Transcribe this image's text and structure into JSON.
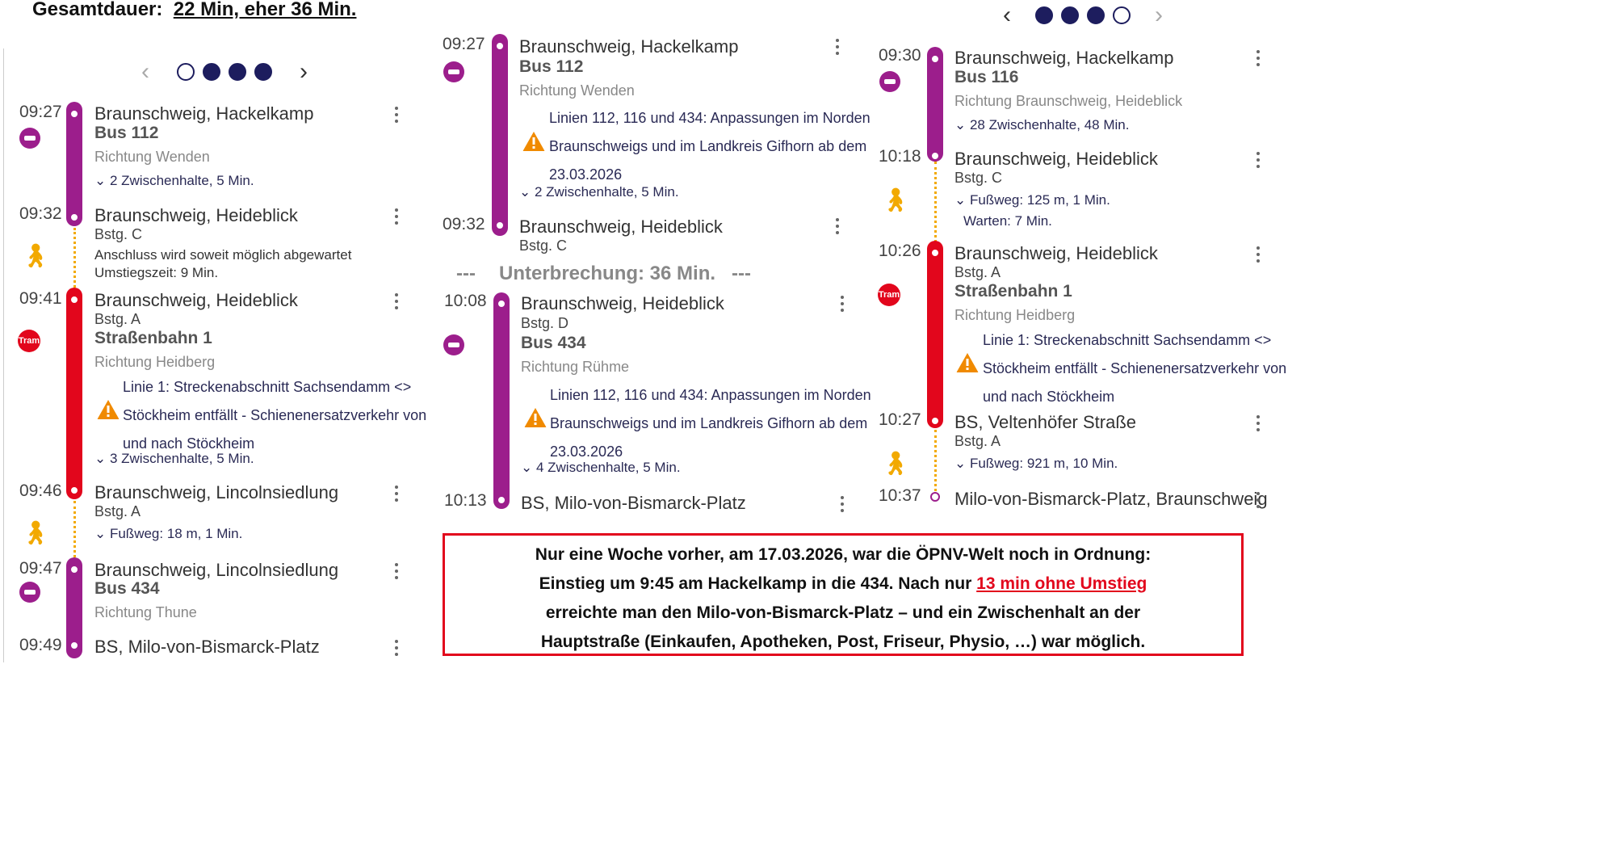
{
  "headline": {
    "label": "Gesamtdauer:",
    "value": "22 Min, eher 36 Min."
  },
  "left": {
    "pager": {
      "prev": "‹",
      "next": "›"
    },
    "rows": {
      "r1": {
        "time": "09:27",
        "stop": "Braunschweig, Hackelkamp",
        "line": "Bus 112",
        "dir": "Richtung Wenden",
        "stops": "⌄ 2 Zwischenhalte, 5 Min."
      },
      "r2": {
        "time": "09:32",
        "stop": "Braunschweig, Heideblick",
        "bay": "Bstg. C",
        "note1": "Anschluss wird soweit möglich abgewartet",
        "note2": "Umstiegszeit: 9 Min."
      },
      "r3": {
        "time": "09:41",
        "stop": "Braunschweig, Heideblick",
        "bay": "Bstg. A",
        "line": "Straßenbahn 1",
        "dir": "Richtung Heidberg",
        "alert1": "Linie 1: Streckenabschnitt Sachsendamm <>",
        "alert2": "Stöckheim entfällt - Schienenersatzverkehr von",
        "alert3": "und nach Stöckheim",
        "stops": "⌄ 3 Zwischenhalte, 5 Min.",
        "tram": "Tram"
      },
      "r4": {
        "time": "09:46",
        "stop": "Braunschweig, Lincolnsiedlung",
        "bay": "Bstg. A",
        "walk": "⌄ Fußweg: 18 m, 1 Min."
      },
      "r5": {
        "time": "09:47",
        "stop": "Braunschweig, Lincolnsiedlung",
        "line": "Bus 434",
        "dir": "Richtung Thune"
      },
      "r6": {
        "time": "09:49",
        "stop": "BS, Milo-von-Bismarck-Platz"
      }
    }
  },
  "mid": {
    "r1": {
      "time": "09:27",
      "stop": "Braunschweig, Hackelkamp",
      "line": "Bus 112",
      "dir": "Richtung Wenden",
      "alert1": "Linien 112, 116 und 434: Anpassungen im Norden",
      "alert2": "Braunschweigs und im Landkreis Gifhorn ab dem",
      "alert3": "23.03.2026",
      "stops": "⌄ 2 Zwischenhalte, 5 Min."
    },
    "r2": {
      "time": "09:32",
      "stop": "Braunschweig, Heideblick",
      "bay": "Bstg. C"
    },
    "break": {
      "dash1": "---",
      "text": "Unterbrechung: 36 Min.",
      "dash2": "---"
    },
    "r3": {
      "time": "10:08",
      "stop": "Braunschweig, Heideblick",
      "bay": "Bstg. D",
      "line": "Bus 434",
      "dir": "Richtung Rühme",
      "alert1": "Linien 112, 116 und 434: Anpassungen im Norden",
      "alert2": "Braunschweigs und im Landkreis Gifhorn ab dem",
      "alert3": "23.03.2026",
      "stops": "⌄ 4 Zwischenhalte, 5 Min."
    },
    "r4": {
      "time": "10:13",
      "stop": "BS, Milo-von-Bismarck-Platz"
    }
  },
  "right": {
    "pager": {
      "prev": "‹",
      "next": "›"
    },
    "r1": {
      "time": "09:30",
      "stop": "Braunschweig, Hackelkamp",
      "line": "Bus 116",
      "dir": "Richtung Braunschweig, Heideblick",
      "stops": "⌄ 28 Zwischenhalte, 48 Min."
    },
    "r2": {
      "time": "10:18",
      "stop": "Braunschweig, Heideblick",
      "bay": "Bstg. C",
      "walk": "⌄ Fußweg: 125 m, 1 Min.",
      "wait": "Warten: 7 Min."
    },
    "r3": {
      "time": "10:26",
      "stop": "Braunschweig, Heideblick",
      "bay": "Bstg. A",
      "line": "Straßenbahn 1",
      "dir": "Richtung Heidberg",
      "alert1": "Linie 1: Streckenabschnitt Sachsendamm <>",
      "alert2": "Stöckheim entfällt - Schienenersatzverkehr von",
      "alert3": "und nach Stöckheim",
      "tram": "Tram"
    },
    "r4": {
      "time": "10:27",
      "stop": "BS, Veltenhöfer Straße",
      "bay": "Bstg. A",
      "walk": "⌄ Fußweg: 921 m, 10 Min."
    },
    "r5": {
      "time": "10:37",
      "stop": "Milo-von-Bismarck-Platz, Braunschweig"
    }
  },
  "note": {
    "l1": "Nur eine Woche vorher, am 17.03.2026, war die ÖPNV-Welt noch in Ordnung:",
    "l2a": "Einstieg um 9:45 am Hackelkamp in die 434. Nach nur ",
    "l2b": "13 min ohne Umstieg",
    "l3": "erreichte man den Milo-von-Bismarck-Platz – und ein Zwischenhalt an der",
    "l4": "Hauptstraße (Einkaufen, Apotheken, Post, Friseur, Physio, …) war möglich."
  },
  "colors": {
    "bus": "#9c1e8c",
    "tram": "#e2061c",
    "walk": "#f2a900",
    "link": "#2a2a55",
    "alert": "#f08a00"
  }
}
